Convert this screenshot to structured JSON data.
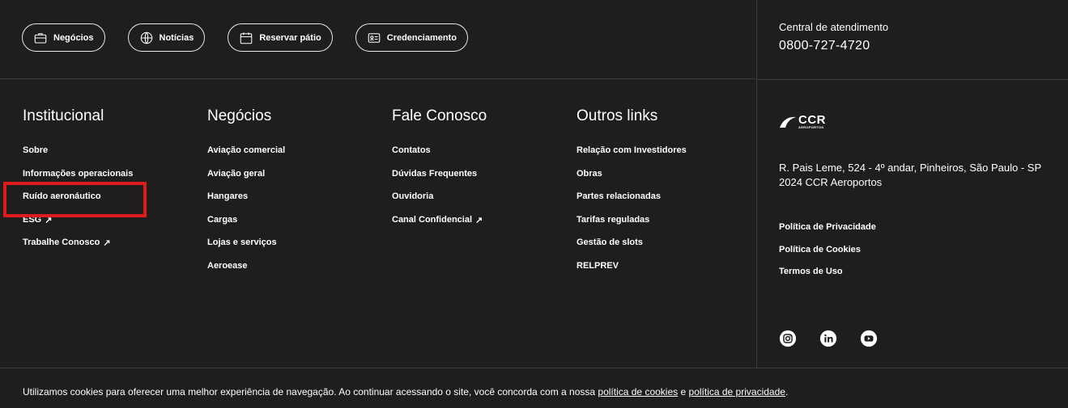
{
  "top_nav": {
    "pills": [
      {
        "label": "Negócios",
        "icon": "briefcase-icon"
      },
      {
        "label": "Notícias",
        "icon": "globe-icon"
      },
      {
        "label": "Reservar pátio",
        "icon": "calendar-icon"
      },
      {
        "label": "Credenciamento",
        "icon": "id-card-icon"
      }
    ]
  },
  "contact": {
    "label": "Central de atendimento",
    "phone": "0800-727-4720"
  },
  "columns": [
    {
      "title": "Institucional",
      "links": [
        "Sobre",
        "Informações operacionais",
        "Ruído aeronáutico",
        "ESG",
        "Trabalhe Conosco"
      ]
    },
    {
      "title": "Negócios",
      "links": [
        "Aviação comercial",
        "Aviação geral",
        "Hangares",
        "Cargas",
        "Lojas e serviços",
        "Aeroease"
      ]
    },
    {
      "title": "Fale Conosco",
      "links": [
        "Contatos",
        "Dúvidas Frequentes",
        "Ouvidoria",
        "Canal Confidencial"
      ]
    },
    {
      "title": "Outros links",
      "links": [
        "Relação com Investidores",
        "Obras",
        "Partes relacionadas",
        "Tarifas reguladas",
        "Gestão de slots",
        "RELPREV"
      ]
    }
  ],
  "external_arrow": "↗",
  "brand": {
    "logo_main": "CCR",
    "logo_sub": "AEROPORTOS"
  },
  "address": {
    "line1": "R. Pais Leme, 524 - 4º andar, Pinheiros, São Paulo - SP",
    "line2": "2024  CCR Aeroportos"
  },
  "legal_links": [
    "Política de Privacidade",
    "Política de Cookies",
    "Termos de Uso"
  ],
  "social": [
    "instagram-icon",
    "linkedin-icon",
    "youtube-icon"
  ],
  "cookie_bar": {
    "text": "Utilizamos cookies para oferecer uma melhor experiência de navegação. Ao continuar acessando o site, você concorda com a nossa",
    "link1": "política de cookies",
    "connector": "e",
    "link2": "política de privacidade",
    "end": "."
  },
  "colors": {
    "background": "#1f1d1d",
    "text": "#ffffff",
    "highlight": "#e01b1b",
    "divider": "#3d3b3b"
  }
}
